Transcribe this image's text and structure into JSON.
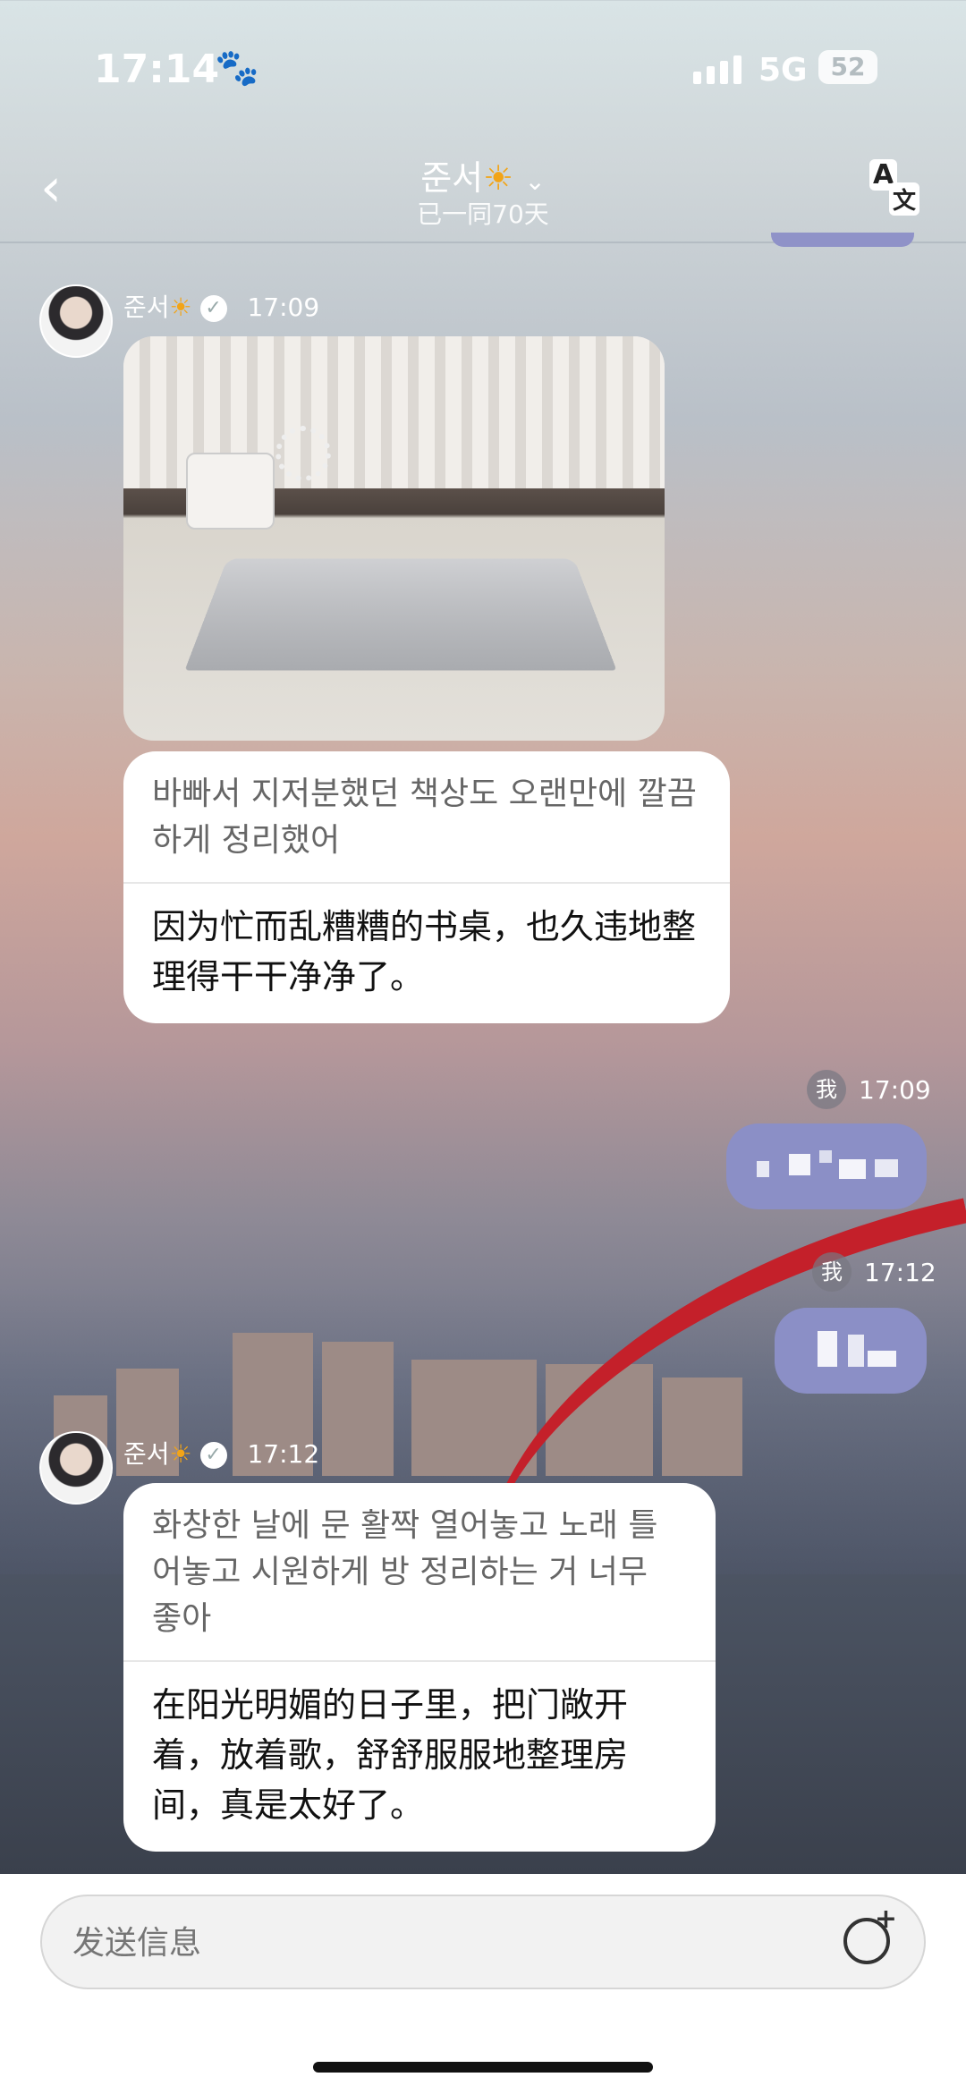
{
  "status": {
    "time": "17:14",
    "network": "5G",
    "battery": "52"
  },
  "header": {
    "name": "준서",
    "sun": "☀",
    "subtitle": "已一同70天",
    "back": "‹",
    "translate_a": "A",
    "translate_b": "文"
  },
  "messages": [
    {
      "sender": "준서",
      "time": "17:09",
      "has_photo": true,
      "original": "바빠서 지저분했던 책상도 오랜만에 깔끔하게 정리했어",
      "translation": "因为忙而乱糟糟的书桌，也久违地整理得干干净净了。"
    },
    {
      "me_label": "我",
      "time": "17:09"
    },
    {
      "me_label": "我",
      "time": "17:12"
    },
    {
      "sender": "준서",
      "time": "17:12",
      "original": "화창한 날에 문 활짝 열어놓고 노래 틀어놓고 시원하게 방 정리하는 거 너무 좋아",
      "translation": "在阳光明媚的日子里，把门敞开着，放着歌，舒舒服服地整理房间，真是太好了。"
    }
  ],
  "input": {
    "placeholder": "发送信息"
  },
  "colors": {
    "my_bubble": "#8b8fc6",
    "sun": "#f2a417",
    "bridge": "#c4202a"
  }
}
